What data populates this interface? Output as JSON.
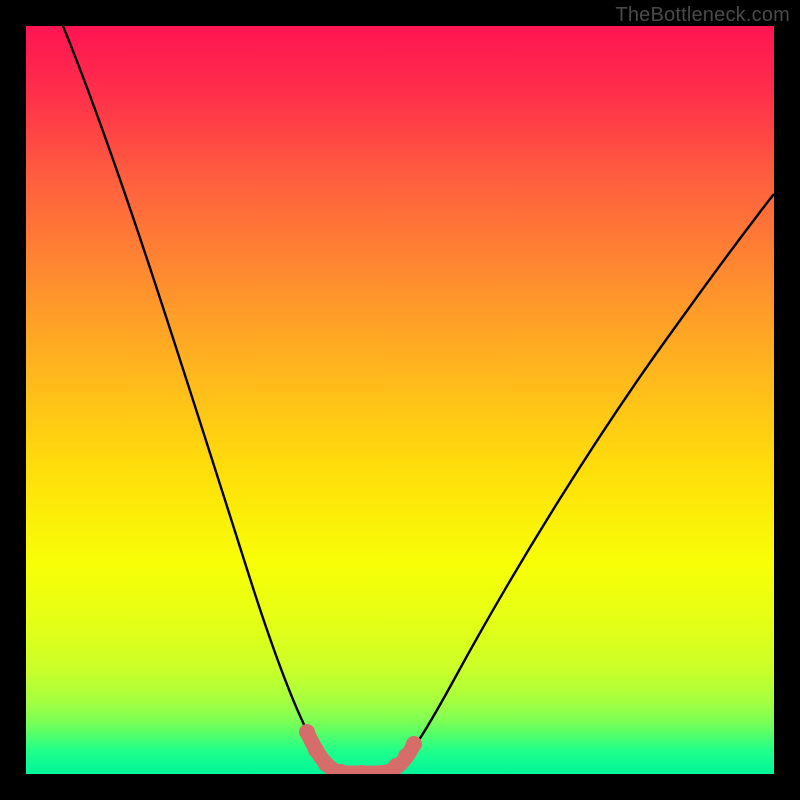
{
  "watermark": "TheBottleneck.com",
  "chart_data": {
    "type": "line",
    "title": "",
    "xlabel": "",
    "ylabel": "",
    "xlim": [
      0,
      100
    ],
    "ylim": [
      0,
      100
    ],
    "series": [
      {
        "name": "bottleneck-curve",
        "x": [
          0,
          5,
          10,
          15,
          20,
          25,
          30,
          35,
          38,
          40,
          42,
          44,
          46,
          48,
          50,
          55,
          60,
          65,
          70,
          75,
          80,
          85,
          90,
          95,
          100
        ],
        "y": [
          100,
          91,
          81,
          71,
          60,
          49,
          37,
          23,
          13,
          6,
          2,
          0,
          0,
          0,
          2,
          7,
          14,
          21,
          28,
          35,
          42,
          48,
          54,
          60,
          65
        ]
      }
    ],
    "highlight": {
      "name": "bottom-region",
      "x": [
        38,
        40,
        42,
        44,
        46,
        48,
        50
      ],
      "y": [
        13,
        6,
        2,
        0,
        0,
        0,
        2
      ]
    }
  }
}
